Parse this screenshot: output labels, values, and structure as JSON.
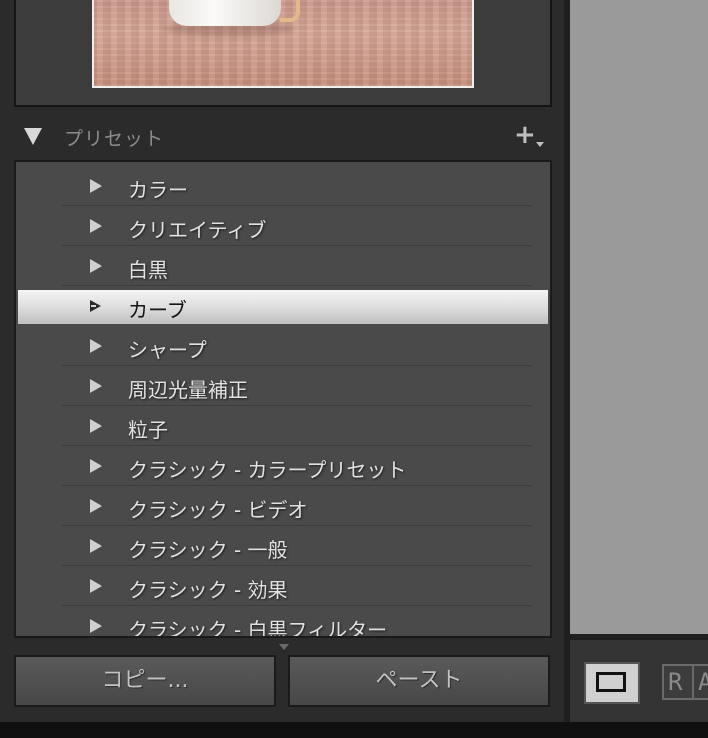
{
  "presets_panel": {
    "title": "プリセット",
    "items": [
      {
        "label": "カラー"
      },
      {
        "label": "クリエイティブ"
      },
      {
        "label": "白黒"
      },
      {
        "label": "カーブ",
        "selected": true
      },
      {
        "label": "シャープ"
      },
      {
        "label": "周辺光量補正"
      },
      {
        "label": "粒子"
      },
      {
        "label": "クラシック - カラープリセット"
      },
      {
        "label": "クラシック - ビデオ"
      },
      {
        "label": "クラシック - 一般"
      },
      {
        "label": "クラシック - 効果"
      },
      {
        "label": "クラシック - 白黒フィルター"
      }
    ]
  },
  "buttons": {
    "copy": "コピー...",
    "paste": "ペースト"
  },
  "toolbar": {
    "ra_first": "R",
    "ra_second": "A"
  },
  "icons": {
    "collapse": "triangle-down-icon",
    "add_preset": "plus-icon",
    "expand": "triangle-right-icon",
    "view_mode": "rectangle-icon"
  },
  "colors": {
    "panel_bg": "#2b2b2b",
    "list_bg": "#4a4a4a",
    "selected_row": "#dedede",
    "canvas": "#9a9a9a"
  }
}
